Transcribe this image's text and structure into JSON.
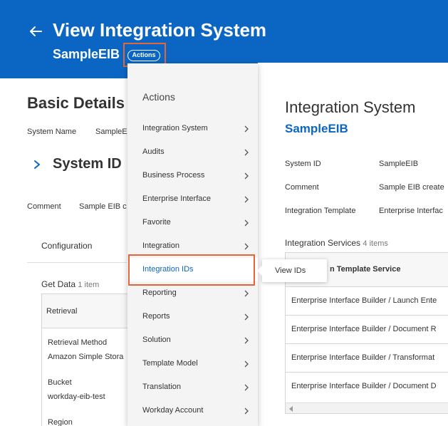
{
  "header": {
    "title": "View Integration System",
    "subtitle": "SampleEIB",
    "actions_label": "Actions",
    "color": "#0b66c3"
  },
  "basic_details": {
    "title": "Basic Details",
    "system_name_label": "System Name",
    "system_name_value": "SampleE",
    "system_id_title": "System ID",
    "comment_label": "Comment",
    "comment_value": "Sample EIB c",
    "tab_configuration": "Configuration",
    "get_data_title": "Get Data",
    "get_data_count": "1 item",
    "retrieval_header": "Retrieval",
    "retrieval_method_label": "Retrieval Method",
    "retrieval_method_value": "Amazon Simple Stora",
    "bucket_label": "Bucket",
    "bucket_value": "workday-eib-test",
    "region_label": "Region"
  },
  "integration_system": {
    "title": "Integration System",
    "subtitle": "SampleEIB",
    "fields": [
      {
        "label": "System ID",
        "value": "SampleEIB"
      },
      {
        "label": "Comment",
        "value": "Sample EIB create"
      },
      {
        "label": "Integration Template",
        "value": "Enterprise Interfac"
      }
    ],
    "services_title": "Integration Services",
    "services_count": "4 items",
    "services_header": "n Template Service",
    "services": [
      "Enterprise Interface Builder / Launch Ente",
      "Enterprise Interface Builder / Document R",
      "Enterprise Interface Builder / Transformat",
      "Enterprise Interface Builder / Document D"
    ]
  },
  "actions_menu": {
    "title": "Actions",
    "items": [
      {
        "label": "Integration System"
      },
      {
        "label": "Audits"
      },
      {
        "label": "Business Process"
      },
      {
        "label": "Enterprise Interface"
      },
      {
        "label": "Favorite"
      },
      {
        "label": "Integration"
      },
      {
        "label": "Integration IDs"
      },
      {
        "label": "Reporting"
      },
      {
        "label": "Reports"
      },
      {
        "label": "Solution"
      },
      {
        "label": "Template Model"
      },
      {
        "label": "Translation"
      },
      {
        "label": "Workday Account"
      }
    ],
    "tooltip": "View IDs",
    "highlight_color": "#e4653a"
  }
}
